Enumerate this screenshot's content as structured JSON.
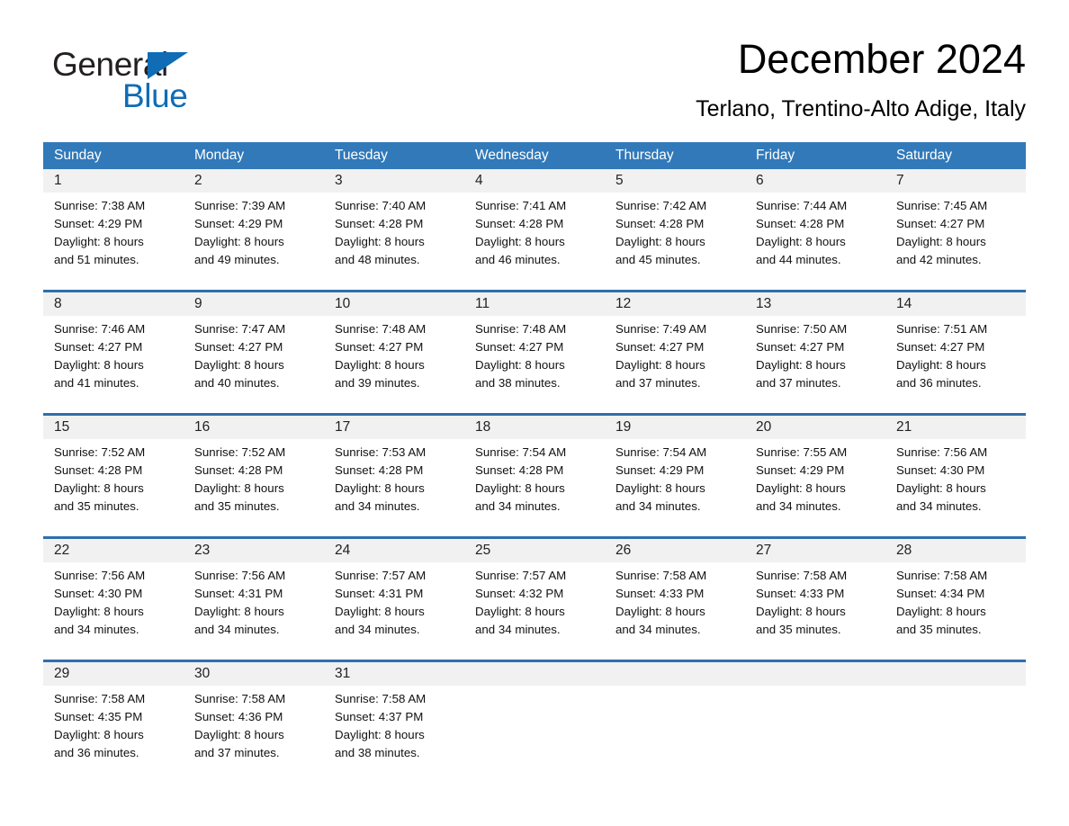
{
  "brand": {
    "name_dark": "General",
    "name_light": "Blue",
    "triangle_color": "#0f6cb5"
  },
  "header": {
    "title": "December 2024",
    "subtitle": "Terlano, Trentino-Alto Adige, Italy"
  },
  "theme": {
    "header_blue": "#3179b9",
    "rule_blue": "#2f6fac",
    "daynum_band": "#f1f1f1",
    "text": "#111111"
  },
  "weekdays": [
    "Sunday",
    "Monday",
    "Tuesday",
    "Wednesday",
    "Thursday",
    "Friday",
    "Saturday"
  ],
  "weeks": [
    [
      {
        "day": "1",
        "info": "Sunrise: 7:38 AM\nSunset: 4:29 PM\nDaylight: 8 hours\nand 51 minutes."
      },
      {
        "day": "2",
        "info": "Sunrise: 7:39 AM\nSunset: 4:29 PM\nDaylight: 8 hours\nand 49 minutes."
      },
      {
        "day": "3",
        "info": "Sunrise: 7:40 AM\nSunset: 4:28 PM\nDaylight: 8 hours\nand 48 minutes."
      },
      {
        "day": "4",
        "info": "Sunrise: 7:41 AM\nSunset: 4:28 PM\nDaylight: 8 hours\nand 46 minutes."
      },
      {
        "day": "5",
        "info": "Sunrise: 7:42 AM\nSunset: 4:28 PM\nDaylight: 8 hours\nand 45 minutes."
      },
      {
        "day": "6",
        "info": "Sunrise: 7:44 AM\nSunset: 4:28 PM\nDaylight: 8 hours\nand 44 minutes."
      },
      {
        "day": "7",
        "info": "Sunrise: 7:45 AM\nSunset: 4:27 PM\nDaylight: 8 hours\nand 42 minutes."
      }
    ],
    [
      {
        "day": "8",
        "info": "Sunrise: 7:46 AM\nSunset: 4:27 PM\nDaylight: 8 hours\nand 41 minutes."
      },
      {
        "day": "9",
        "info": "Sunrise: 7:47 AM\nSunset: 4:27 PM\nDaylight: 8 hours\nand 40 minutes."
      },
      {
        "day": "10",
        "info": "Sunrise: 7:48 AM\nSunset: 4:27 PM\nDaylight: 8 hours\nand 39 minutes."
      },
      {
        "day": "11",
        "info": "Sunrise: 7:48 AM\nSunset: 4:27 PM\nDaylight: 8 hours\nand 38 minutes."
      },
      {
        "day": "12",
        "info": "Sunrise: 7:49 AM\nSunset: 4:27 PM\nDaylight: 8 hours\nand 37 minutes."
      },
      {
        "day": "13",
        "info": "Sunrise: 7:50 AM\nSunset: 4:27 PM\nDaylight: 8 hours\nand 37 minutes."
      },
      {
        "day": "14",
        "info": "Sunrise: 7:51 AM\nSunset: 4:27 PM\nDaylight: 8 hours\nand 36 minutes."
      }
    ],
    [
      {
        "day": "15",
        "info": "Sunrise: 7:52 AM\nSunset: 4:28 PM\nDaylight: 8 hours\nand 35 minutes."
      },
      {
        "day": "16",
        "info": "Sunrise: 7:52 AM\nSunset: 4:28 PM\nDaylight: 8 hours\nand 35 minutes."
      },
      {
        "day": "17",
        "info": "Sunrise: 7:53 AM\nSunset: 4:28 PM\nDaylight: 8 hours\nand 34 minutes."
      },
      {
        "day": "18",
        "info": "Sunrise: 7:54 AM\nSunset: 4:28 PM\nDaylight: 8 hours\nand 34 minutes."
      },
      {
        "day": "19",
        "info": "Sunrise: 7:54 AM\nSunset: 4:29 PM\nDaylight: 8 hours\nand 34 minutes."
      },
      {
        "day": "20",
        "info": "Sunrise: 7:55 AM\nSunset: 4:29 PM\nDaylight: 8 hours\nand 34 minutes."
      },
      {
        "day": "21",
        "info": "Sunrise: 7:56 AM\nSunset: 4:30 PM\nDaylight: 8 hours\nand 34 minutes."
      }
    ],
    [
      {
        "day": "22",
        "info": "Sunrise: 7:56 AM\nSunset: 4:30 PM\nDaylight: 8 hours\nand 34 minutes."
      },
      {
        "day": "23",
        "info": "Sunrise: 7:56 AM\nSunset: 4:31 PM\nDaylight: 8 hours\nand 34 minutes."
      },
      {
        "day": "24",
        "info": "Sunrise: 7:57 AM\nSunset: 4:31 PM\nDaylight: 8 hours\nand 34 minutes."
      },
      {
        "day": "25",
        "info": "Sunrise: 7:57 AM\nSunset: 4:32 PM\nDaylight: 8 hours\nand 34 minutes."
      },
      {
        "day": "26",
        "info": "Sunrise: 7:58 AM\nSunset: 4:33 PM\nDaylight: 8 hours\nand 34 minutes."
      },
      {
        "day": "27",
        "info": "Sunrise: 7:58 AM\nSunset: 4:33 PM\nDaylight: 8 hours\nand 35 minutes."
      },
      {
        "day": "28",
        "info": "Sunrise: 7:58 AM\nSunset: 4:34 PM\nDaylight: 8 hours\nand 35 minutes."
      }
    ],
    [
      {
        "day": "29",
        "info": "Sunrise: 7:58 AM\nSunset: 4:35 PM\nDaylight: 8 hours\nand 36 minutes."
      },
      {
        "day": "30",
        "info": "Sunrise: 7:58 AM\nSunset: 4:36 PM\nDaylight: 8 hours\nand 37 minutes."
      },
      {
        "day": "31",
        "info": "Sunrise: 7:58 AM\nSunset: 4:37 PM\nDaylight: 8 hours\nand 38 minutes."
      },
      {
        "day": "",
        "info": ""
      },
      {
        "day": "",
        "info": ""
      },
      {
        "day": "",
        "info": ""
      },
      {
        "day": "",
        "info": ""
      }
    ]
  ]
}
